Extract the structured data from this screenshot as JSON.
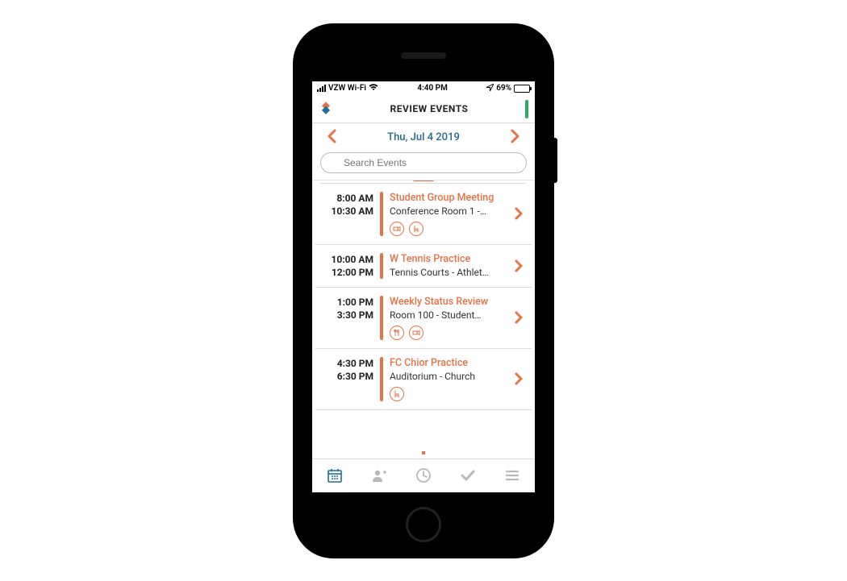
{
  "status_bar": {
    "carrier": "VZW Wi-Fi",
    "time": "4:40 PM",
    "battery_pct": "69%"
  },
  "header": {
    "title": "REVIEW EVENTS"
  },
  "date_nav": {
    "date_label": "Thu, Jul 4 2019"
  },
  "search": {
    "placeholder": "Search Events"
  },
  "events": [
    {
      "start": "8:00 AM",
      "end": "10:30 AM",
      "title": "Student Group Meeting",
      "location": "Conference Room 1 -…",
      "icons": [
        "camera-icon",
        "chair-icon"
      ]
    },
    {
      "start": "10:00 AM",
      "end": "12:00 PM",
      "title": "W Tennis Practice",
      "location": "Tennis Courts - Athlet…",
      "icons": []
    },
    {
      "start": "1:00 PM",
      "end": "3:30 PM",
      "title": "Weekly Status Review",
      "location": "Room 100 - Student…",
      "icons": [
        "food-icon",
        "camera-icon"
      ]
    },
    {
      "start": "4:30 PM",
      "end": "6:30 PM",
      "title": "FC Chior Practice",
      "location": "Auditorium - Church",
      "icons": [
        "chair-icon"
      ]
    }
  ],
  "icon_glyphs": {
    "camera-icon": "■",
    "chair-icon": "⌐",
    "food-icon": "✦"
  },
  "tabs": {
    "active": "calendar"
  },
  "colors": {
    "accent": "#e67345",
    "brand_blue": "#1e6f99",
    "status_green": "#27ae60"
  }
}
